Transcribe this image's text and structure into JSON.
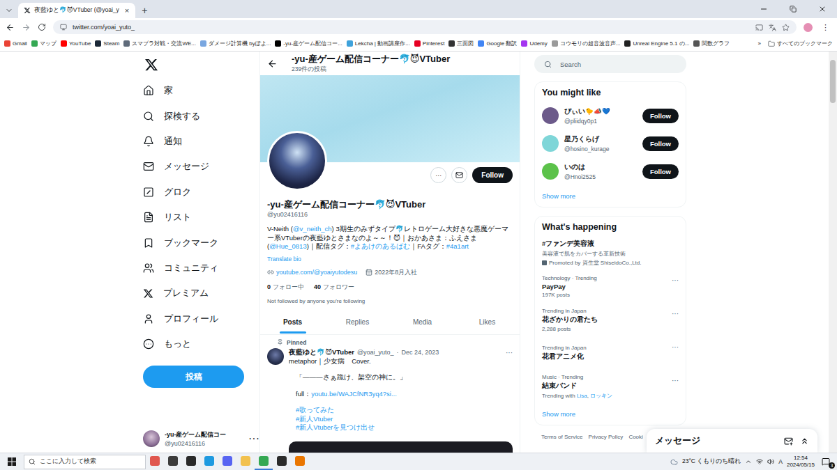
{
  "browser": {
    "tab": {
      "title": "夜藍ゆと🐬😈VTuber (@yoai_y",
      "close": "×",
      "new": "+"
    },
    "url": "twitter.com/yoai_yuto_",
    "bookmarks": [
      {
        "label": "Gmail",
        "color": "#ea4335"
      },
      {
        "label": "マップ",
        "color": "#34a853"
      },
      {
        "label": "YouTube",
        "color": "#ff0000"
      },
      {
        "label": "Steam",
        "color": "#1b2838"
      },
      {
        "label": "スマブラ対戦・交流WE...",
        "color": "#5f6b7a"
      },
      {
        "label": "ダメージ計算機 byぽよ...",
        "color": "#7aa7e0"
      },
      {
        "label": "-yu-産ゲーム配信コー...",
        "color": "#000000"
      },
      {
        "label": "Lekcha | 動画講座作...",
        "color": "#3fa2db"
      },
      {
        "label": "Pinterest",
        "color": "#e60023"
      },
      {
        "label": "三面図",
        "color": "#333333"
      },
      {
        "label": "Google 翻訳",
        "color": "#4285f4"
      },
      {
        "label": "Udemy",
        "color": "#a435f0"
      },
      {
        "label": "コウモリの超音波音声...",
        "color": "#9a9a9a"
      },
      {
        "label": "Unreal Engine 5.1 の...",
        "color": "#222222"
      },
      {
        "label": "関数グラフ",
        "color": "#555555"
      }
    ],
    "bookmarks_more": "»",
    "all_bookmarks": "すべてのブックマーク"
  },
  "nav": {
    "items": [
      {
        "label": "家",
        "selected": false
      },
      {
        "label": "探検する",
        "selected": false
      },
      {
        "label": "通知",
        "selected": false
      },
      {
        "label": "メッセージ",
        "selected": false
      },
      {
        "label": "グロク",
        "selected": false
      },
      {
        "label": "リスト",
        "selected": false
      },
      {
        "label": "ブックマーク",
        "selected": false
      },
      {
        "label": "コミュニティ",
        "selected": false
      },
      {
        "label": "プレミアム",
        "selected": false
      },
      {
        "label": "プロフィール",
        "selected": false
      },
      {
        "label": "もっと",
        "selected": false
      }
    ],
    "post_button": "投稿",
    "account": {
      "name": "-yu-産ゲーム配信コー",
      "handle": "@yu02416116",
      "more": "···"
    }
  },
  "profile": {
    "header_title": "-yu-産ゲーム配信コーナー🐬😈VTuber",
    "post_count": "239件の投稿",
    "more": "···",
    "follow_button": "Follow",
    "name": "-yu-産ゲーム配信コーナー🐬😈VTuber",
    "handle": "@yu02416116",
    "bio": [
      {
        "text": "V-Neith (",
        "link": false
      },
      {
        "text": "@v_neith_ch",
        "link": true
      },
      {
        "text": ") 3期生のみずタイプ🐬レトロゲーム大好きな悪魔ゲーマー系VTuberの夜藍ゆとさまなのよ～～！😈｜おかあさま：ふえさま(",
        "link": false
      },
      {
        "text": "@Hue_0813",
        "link": true
      },
      {
        "text": ")｜配信タグ：",
        "link": false
      },
      {
        "text": "#よあけのあるばむ",
        "link": true
      },
      {
        "text": "｜FAタグ：",
        "link": false
      },
      {
        "text": "#4a1art",
        "link": true
      }
    ],
    "translate": "Translate bio",
    "link": "youtube.com/@yoaiyutodesu",
    "joined": "2022年8月入社",
    "following_count": "0",
    "following_label": "フォロー中",
    "followers_count": "40",
    "followers_label": "フォロワー",
    "not_followed": "Not followed by anyone you're following"
  },
  "tabs": [
    {
      "label": "Posts",
      "selected": true
    },
    {
      "label": "Replies",
      "selected": false
    },
    {
      "label": "Media",
      "selected": false
    },
    {
      "label": "Likes",
      "selected": false
    }
  ],
  "pinned_post": {
    "label": "Pinned",
    "author": "夜藍ゆと🐬😈VTuber",
    "handle": "@yoai_yuto_",
    "separator": "·",
    "date": "Dec 24, 2023",
    "more": "···",
    "paragraphs": [
      [
        [
          {
            "text": "metaphor｜少女病　Cover.",
            "link": false
          }
        ]
      ],
      [
        [
          {
            "text": "　「―――さぁ跪け、架空の神に。」",
            "link": false
          }
        ]
      ],
      [
        [
          {
            "text": "　full：",
            "link": false
          },
          {
            "text": "youtu.be/WAJCfNR3yq4?si...",
            "link": true
          }
        ]
      ],
      [
        [
          {
            "text": "　#歌ってみた",
            "link": true
          }
        ],
        [
          {
            "text": "　#新人Vtuber",
            "link": true
          }
        ],
        [
          {
            "text": "　#新人Vtuberを見つけ出せ",
            "link": true
          }
        ]
      ]
    ]
  },
  "sidebar": {
    "search_placeholder": "Search",
    "you_might_like": {
      "title": "You might like",
      "users": [
        {
          "name": "ぴぃい🐤📣💙",
          "handle": "@pliidqy0p1",
          "button": "Follow",
          "color": "#6c5a8a"
        },
        {
          "name": "星乃くらげ",
          "handle": "@hosino_kurage",
          "button": "Follow",
          "color": "#7fd6d8"
        },
        {
          "name": "いのは",
          "handle": "@Hnoi2525",
          "button": "Follow",
          "color": "#5cc24a"
        }
      ],
      "show_more": "Show more"
    },
    "whats_happening": {
      "title": "What's happening",
      "items": [
        {
          "kind": "promoted",
          "context": "",
          "title": "#ファンデ美容液",
          "subtitle": "美容液で肌をカバーする革新技術",
          "meta": [
            {
              "text": "Promoted by 資生堂 ShiseidoCo.,Ltd.",
              "link": false
            }
          ],
          "more": ""
        },
        {
          "kind": "trend",
          "context": "Technology · Trending",
          "title": "PayPay",
          "subtitle": "",
          "meta": [
            {
              "text": "197K posts",
              "link": false
            }
          ],
          "more": "···"
        },
        {
          "kind": "trend",
          "context": "Trending in Japan",
          "title": "花ざかりの君たち",
          "subtitle": "",
          "meta": [
            {
              "text": "2,288 posts",
              "link": false
            }
          ],
          "more": "···"
        },
        {
          "kind": "trend",
          "context": "Trending in Japan",
          "title": "花君アニメ化",
          "subtitle": "",
          "meta": [],
          "more": "···"
        },
        {
          "kind": "trend",
          "context": "Music · Trending",
          "title": "結束バンド",
          "subtitle": "",
          "meta": [
            {
              "text": "Trending with ",
              "link": false
            },
            {
              "text": "Lisa",
              "link": true
            },
            {
              "text": ", ",
              "link": false
            },
            {
              "text": "ロッキン",
              "link": true
            }
          ],
          "more": "···"
        }
      ],
      "show_more": "Show more"
    },
    "footer": [
      "Terms of Service",
      "Privacy Policy",
      "Cooki"
    ]
  },
  "messages_drawer": {
    "title": "メッセージ"
  },
  "taskbar": {
    "search_placeholder": "ここに入力して検索",
    "apps": [
      {
        "color": "#e0574f",
        "selected": false
      },
      {
        "color": "#3c3c3c",
        "selected": false
      },
      {
        "color": "#2a2a2a",
        "selected": false
      },
      {
        "color": "#1f9ae0",
        "selected": false
      },
      {
        "color": "#5865f2",
        "selected": false
      },
      {
        "color": "#f2c14e",
        "selected": false
      },
      {
        "color": "#34a853",
        "selected": true
      },
      {
        "color": "#2b2b2b",
        "selected": false
      },
      {
        "color": "#ea7600",
        "selected": false
      }
    ],
    "weather": "23°C くもりのち晴れ",
    "ime": "A",
    "time": "12:54",
    "date": "2024/05/15",
    "notifications": "3"
  }
}
